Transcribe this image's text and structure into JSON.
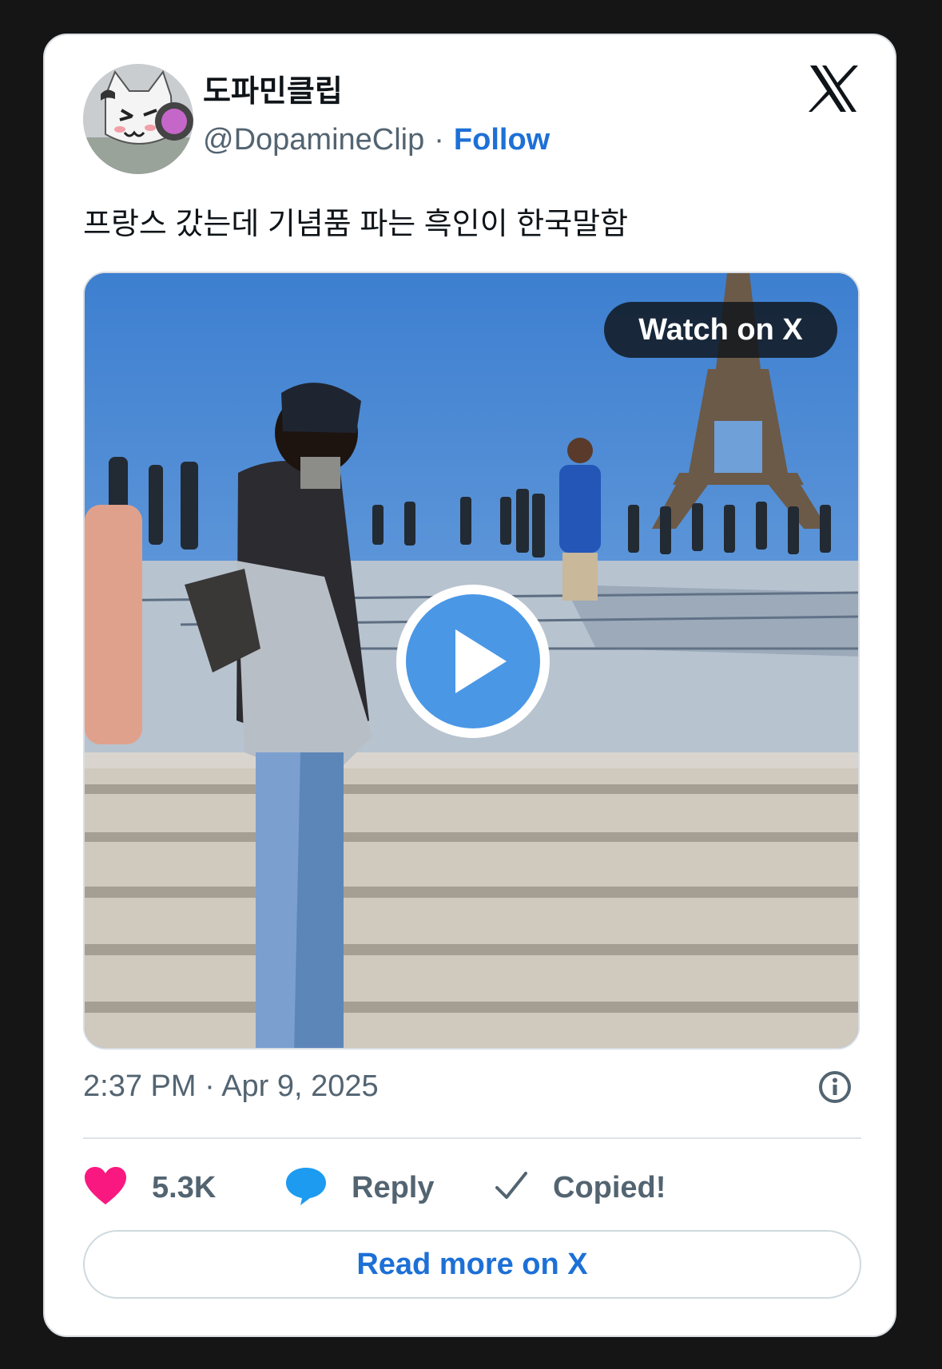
{
  "author": {
    "display_name": "도파민클립",
    "handle": "@DopamineClip",
    "separator": "·",
    "follow_label": "Follow"
  },
  "tweet": {
    "text": "프랑스 갔는데 기념품 파는 흑인이 한국말함",
    "timestamp": "2:37 PM · Apr 9, 2025"
  },
  "media": {
    "watch_label": "Watch on X",
    "type": "video"
  },
  "actions": {
    "like_count": "5.3K",
    "reply_label": "Reply",
    "copy_label": "Copied!"
  },
  "footer": {
    "read_more_label": "Read more on X"
  },
  "icons": {
    "brand": "x-logo-icon",
    "like": "heart-icon",
    "reply": "speech-bubble-icon",
    "copy": "checkmark-icon",
    "info": "info-icon",
    "play": "play-icon"
  },
  "colors": {
    "accent": "#1d70d6",
    "like": "#f91880",
    "reply": "#1d9bf0",
    "play": "#4a97e6",
    "muted": "#536471",
    "text": "#0f1419"
  }
}
